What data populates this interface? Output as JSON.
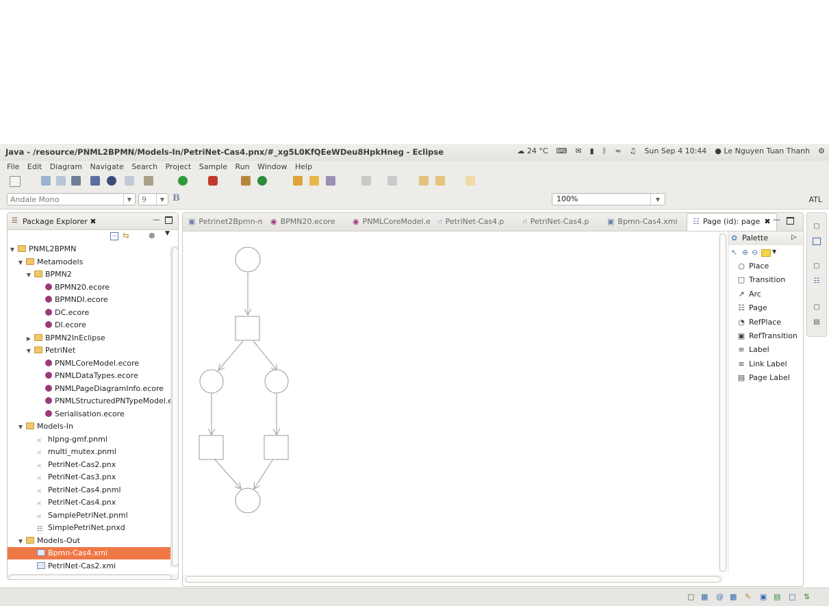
{
  "window": {
    "title": "Java - /resource/PNML2BPMN/Models-In/PetriNet-Cas4.pnx/#_xg5L0KfQEeWDeu8HpkHneg - Eclipse"
  },
  "tray": {
    "weather": "24 °C",
    "datetime": "Sun Sep  4 10:44",
    "user": "Le Nguyen Tuan Thanh"
  },
  "menu": [
    "File",
    "Edit",
    "Diagram",
    "Navigate",
    "Search",
    "Project",
    "Sample",
    "Run",
    "Window",
    "Help"
  ],
  "format_toolbar": {
    "font_name": "Andale Mono",
    "font_size": "9",
    "bold_label": "B",
    "zoom": "100%",
    "perspective": "ATL"
  },
  "explorer": {
    "title": "Package Explorer",
    "tree": [
      {
        "label": "PNML2BPMN",
        "type": "project",
        "depth": 0,
        "twisty": "open"
      },
      {
        "label": "Metamodels",
        "type": "folder",
        "depth": 1,
        "twisty": "open"
      },
      {
        "label": "BPMN2",
        "type": "folder",
        "depth": 2,
        "twisty": "open"
      },
      {
        "label": "BPMN20.ecore",
        "type": "ecore",
        "depth": 3
      },
      {
        "label": "BPMNDI.ecore",
        "type": "ecore",
        "depth": 3
      },
      {
        "label": "DC.ecore",
        "type": "ecore",
        "depth": 3
      },
      {
        "label": "DI.ecore",
        "type": "ecore",
        "depth": 3
      },
      {
        "label": "BPMN2InEclipse",
        "type": "folder",
        "depth": 2,
        "twisty": "closed"
      },
      {
        "label": "PetriNet",
        "type": "folder",
        "depth": 2,
        "twisty": "open"
      },
      {
        "label": "PNMLCoreModel.ecore",
        "type": "ecore",
        "depth": 3
      },
      {
        "label": "PNMLDataTypes.ecore",
        "type": "ecore",
        "depth": 3
      },
      {
        "label": "PNMLPageDiagramInfo.ecore",
        "type": "ecore",
        "depth": 3
      },
      {
        "label": "PNMLStructuredPNTypeModel.ecore",
        "type": "ecore",
        "depth": 3
      },
      {
        "label": "Serialisation.ecore",
        "type": "ecore",
        "depth": 3
      },
      {
        "label": "Models-In",
        "type": "folder",
        "depth": 1,
        "twisty": "open"
      },
      {
        "label": "hlpng-gmf.pnml",
        "type": "pn",
        "depth": 2
      },
      {
        "label": "multi_mutex.pnml",
        "type": "pn",
        "depth": 2
      },
      {
        "label": "PetriNet-Cas2.pnx",
        "type": "pn",
        "depth": 2
      },
      {
        "label": "PetriNet-Cas3.pnx",
        "type": "pn",
        "depth": 2
      },
      {
        "label": "PetriNet-Cas4.pnml",
        "type": "pn",
        "depth": 2
      },
      {
        "label": "PetriNet-Cas4.pnx",
        "type": "pn",
        "depth": 2
      },
      {
        "label": "SamplePetriNet.pnml",
        "type": "pn",
        "depth": 2
      },
      {
        "label": "SimplePetriNet.pnxd",
        "type": "pnxd",
        "depth": 2
      },
      {
        "label": "Models-Out",
        "type": "folder",
        "depth": 1,
        "twisty": "open"
      },
      {
        "label": "Bpmn-Cas4.xmi",
        "type": "xmi",
        "depth": 2,
        "selected": true
      },
      {
        "label": "PetriNet-Cas2.xmi",
        "type": "file",
        "depth": 2
      }
    ]
  },
  "editor": {
    "tabs": [
      {
        "label": "Petrinet2Bpmn-n",
        "icon": "atl-icon"
      },
      {
        "label": "BPMN20.ecore",
        "icon": "ecore-icon"
      },
      {
        "label": "PNMLCoreModel.e",
        "icon": "ecore-icon"
      },
      {
        "label": "PetriNet-Cas4.p",
        "icon": "petrinet-icon"
      },
      {
        "label": "PetriNet-Cas4.p",
        "icon": "petrinet-icon"
      },
      {
        "label": "Bpmn-Cas4.xmi",
        "icon": "xmi-icon"
      },
      {
        "label": "Page (id): page",
        "icon": "page-icon",
        "active": true
      }
    ]
  },
  "palette": {
    "title": "Palette",
    "items": [
      {
        "label": "Place",
        "icon": "circle-icon"
      },
      {
        "label": "Transition",
        "icon": "square-icon"
      },
      {
        "label": "Arc",
        "icon": "arrow-icon"
      },
      {
        "label": "Page",
        "icon": "page-icon"
      },
      {
        "label": "RefPlace",
        "icon": "refplace-icon"
      },
      {
        "label": "RefTransition",
        "icon": "reftransition-icon"
      },
      {
        "label": "Label",
        "icon": "label-icon"
      },
      {
        "label": "Link Label",
        "icon": "link-label-icon"
      },
      {
        "label": "Page Label",
        "icon": "page-label-icon"
      }
    ]
  },
  "colors": {
    "selection": "#f07746",
    "diagram_stroke": "#9a9a9a"
  }
}
